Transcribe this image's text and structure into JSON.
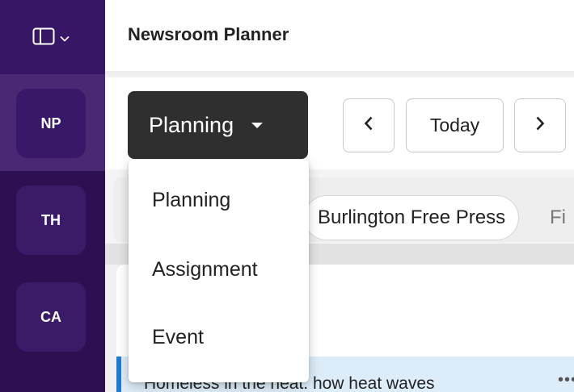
{
  "app": {
    "title": "Newsroom Planner"
  },
  "workspaces": [
    {
      "initials": "NP",
      "active": true
    },
    {
      "initials": "TH",
      "active": false
    },
    {
      "initials": "CA",
      "active": false
    }
  ],
  "toolbar": {
    "type_selector_label": "Planning",
    "prev_icon": "chevron-left-icon",
    "today_label": "Today",
    "next_icon": "chevron-right-icon"
  },
  "type_menu": {
    "items": [
      {
        "label": "Planning"
      },
      {
        "label": "Assignment"
      },
      {
        "label": "Event"
      }
    ]
  },
  "filters": {
    "source_chip": "Burlington Free Press",
    "partial_label": "Fi"
  },
  "list": {
    "items": [
      {
        "title": "Homeless in the heat: how heat waves",
        "more_icon": "more-horizontal-icon"
      }
    ]
  },
  "colors": {
    "rail_background": "#2c1052",
    "rail_active": "#4a2873",
    "selector_background": "#2f2f2f",
    "selected_row": "#dcecf8",
    "row_accent": "#1f7ad0"
  }
}
